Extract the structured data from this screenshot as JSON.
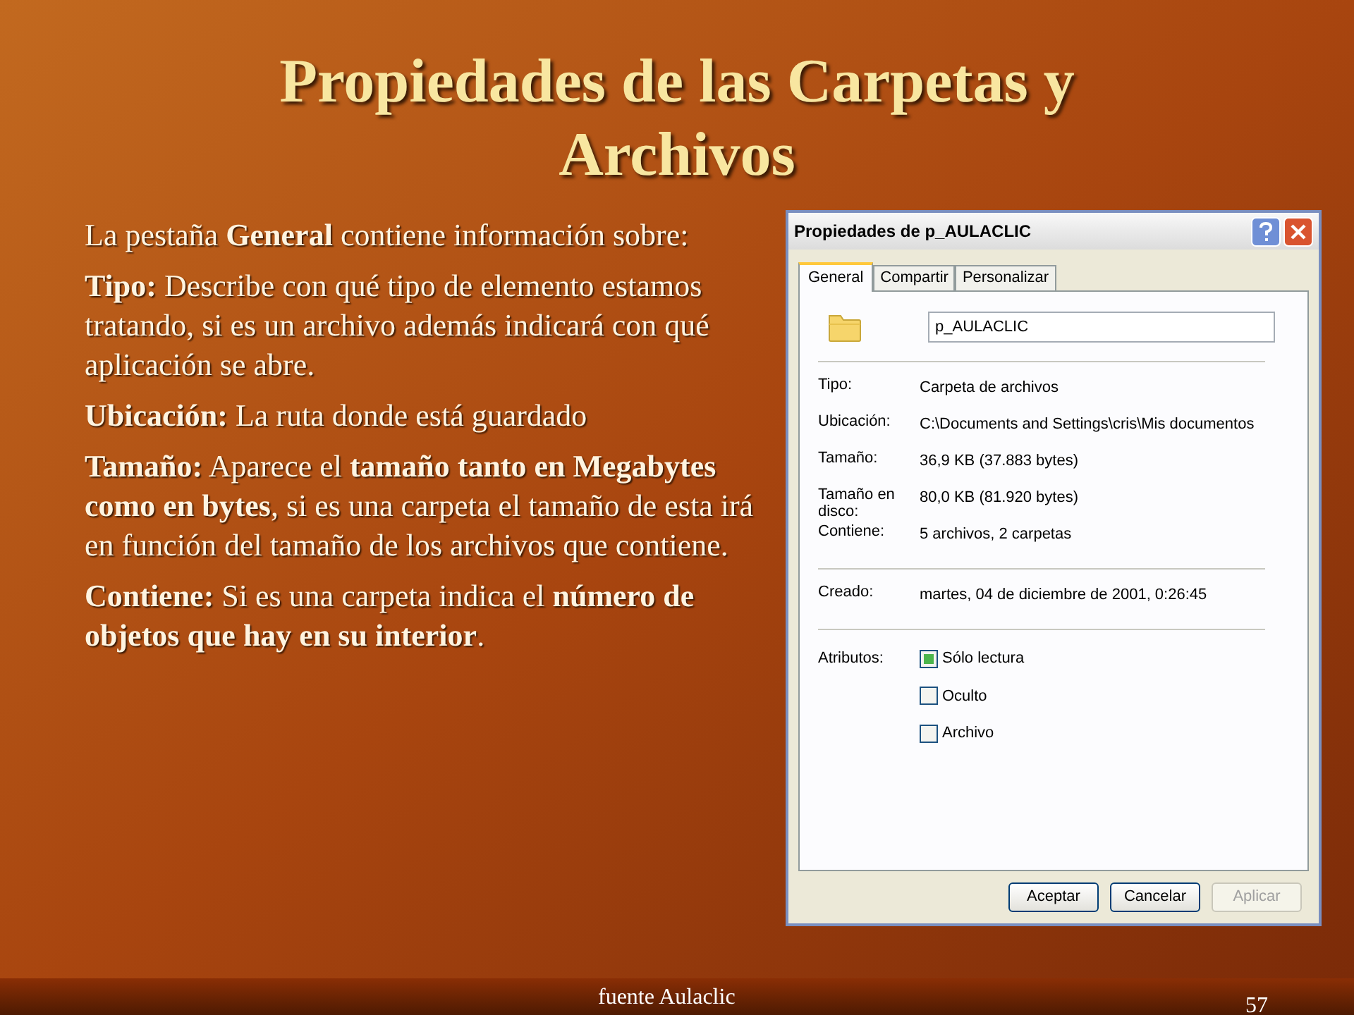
{
  "slide": {
    "title": "Propiedades de las Carpetas y Archivos",
    "paragraphs": [
      "La pestaña **General** contiene información sobre:",
      "**Tipo:** Describe con qué tipo de elemento estamos tratando, si es un archivo además indicará con qué aplicación se abre.",
      "**Ubicación:** La ruta donde está guardado",
      "**Tamaño:** Aparece el **tamaño tanto en Megabytes como en bytes**, si es una carpeta el tamaño de esta irá en función del tamaño de los archivos que contiene.",
      "**Contiene:** Si es una carpeta indica el **número de objetos que hay en su interior**."
    ],
    "footer": "fuente Aulaclic",
    "page_number": "57"
  },
  "dialog": {
    "title": "Propiedades de p_AULACLIC",
    "tabs": [
      {
        "label": "General",
        "selected": true
      },
      {
        "label": "Compartir",
        "selected": false
      },
      {
        "label": "Personalizar",
        "selected": false
      }
    ],
    "name_field": {
      "value": "p_AULACLIC"
    },
    "sections": [
      [
        {
          "label": "Tipo:",
          "value": "Carpeta de archivos"
        },
        {
          "label": "Ubicación:",
          "value": "C:\\Documents and Settings\\cris\\Mis documentos"
        },
        {
          "label": "Tamaño:",
          "value": "36,9 KB (37.883 bytes)"
        },
        {
          "label": "Tamaño en disco:",
          "value": "80,0 KB (81.920 bytes)"
        },
        {
          "label": "Contiene:",
          "value": "5 archivos, 2 carpetas"
        }
      ],
      [
        {
          "label": "Creado:",
          "value": "martes, 04 de diciembre de 2001, 0:26:45"
        }
      ]
    ],
    "attributes": {
      "label": "Atributos:",
      "items": [
        {
          "label": "Sólo lectura",
          "checked": true
        },
        {
          "label": "Oculto",
          "checked": false
        },
        {
          "label": "Archivo",
          "checked": false
        }
      ]
    },
    "buttons": [
      {
        "label": "Aceptar",
        "disabled": false
      },
      {
        "label": "Cancelar",
        "disabled": false
      },
      {
        "label": "Aplicar",
        "disabled": true
      }
    ]
  }
}
